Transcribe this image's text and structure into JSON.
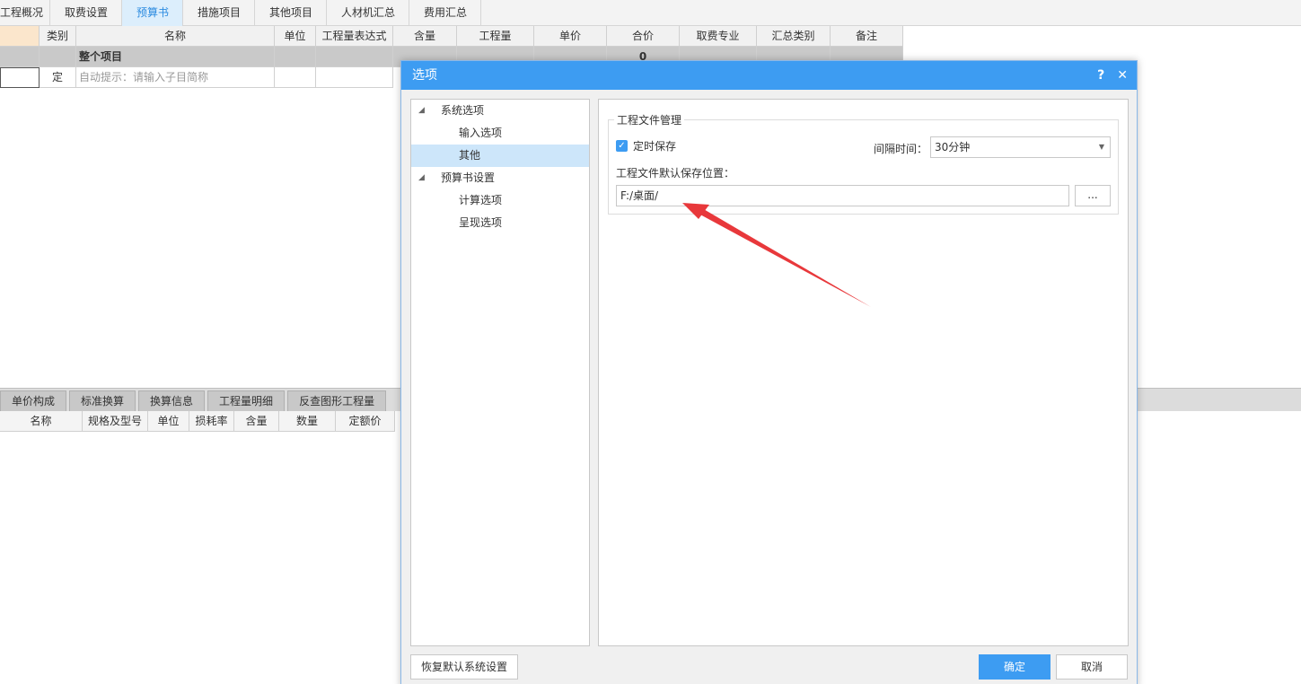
{
  "top_tabs": [
    "工程概况",
    "取费设置",
    "预算书",
    "措施项目",
    "其他项目",
    "人材机汇总",
    "费用汇总"
  ],
  "grid": {
    "headers": [
      "",
      "类别",
      "名称",
      "单位",
      "工程量表达式",
      "含量",
      "工程量",
      "单价",
      "合价",
      "取费专业",
      "汇总类别",
      "备注"
    ],
    "group_row": {
      "name": "整个项目",
      "total": "0"
    },
    "edit_row": {
      "type": "定",
      "name_hint": "自动提示：请输入子目简称"
    }
  },
  "lower": {
    "tabs": [
      "单价构成",
      "标准换算",
      "换算信息",
      "工程量明细",
      "反查图形工程量"
    ],
    "headers": [
      "名称",
      "规格及型号",
      "单位",
      "损耗率",
      "含量",
      "数量",
      "定额价"
    ]
  },
  "dialog": {
    "title": "选项",
    "help_glyph": "?",
    "close_glyph": "✕",
    "tree": [
      {
        "label": "系统选项",
        "level": 0,
        "arrow": "◢"
      },
      {
        "label": "输入选项",
        "level": 1
      },
      {
        "label": "其他",
        "level": 1,
        "selected": true
      },
      {
        "label": "预算书设置",
        "level": 0,
        "arrow": "◢"
      },
      {
        "label": "计算选项",
        "level": 1
      },
      {
        "label": "呈现选项",
        "level": 1
      }
    ],
    "group_title": "工程文件管理",
    "autosave_label": "定时保存",
    "autosave_checked": true,
    "interval_label": "间隔时间：",
    "interval_value": "30分钟",
    "path_label": "工程文件默认保存位置：",
    "path_value": "F:/桌面/",
    "browse_label": "...",
    "restore_label": "恢复默认系统设置",
    "ok_label": "确定",
    "cancel_label": "取消"
  },
  "colors": {
    "accent": "#3d9cf2",
    "active_tab_bg": "#dceefc",
    "arrow": "#e8383b"
  }
}
